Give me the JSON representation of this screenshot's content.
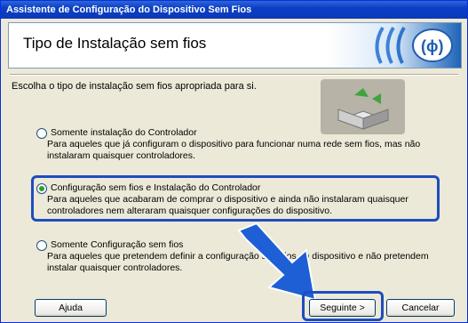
{
  "window": {
    "title": "Assistente de Configuração do Dispositivo Sem Fios"
  },
  "header": {
    "title": "Tipo de Instalação sem fios",
    "logo_icon": "wireless-logo-icon"
  },
  "intro": "Escolha o tipo de instalação sem fios apropriada para si.",
  "options": [
    {
      "label": "Somente instalação do Controlador",
      "description": "Para aqueles que já configuram o dispositivo para funcionar numa rede sem fios, mas não instalaram quaisquer controladores.",
      "selected": false
    },
    {
      "label": "Configuração sem fios e Instalação do Controlador",
      "description": "Para aqueles que acabaram de comprar o dispositivo e ainda não instalaram quaisquer controladores nem alteraram quaisquer configurações do dispositivo.",
      "selected": true
    },
    {
      "label": "Somente Configuração sem fios",
      "description": "Para aqueles que pretendem definir a configuração sem fios do dispositivo e não pretendem instalar quaisquer controladores.",
      "selected": false
    }
  ],
  "buttons": {
    "help": "Ajuda",
    "next": "Seguinte >",
    "cancel": "Cancelar"
  },
  "colors": {
    "titlebar": "#0a3fc6",
    "highlight": "#1f4dbf",
    "arrow": "#1f5fd6"
  }
}
